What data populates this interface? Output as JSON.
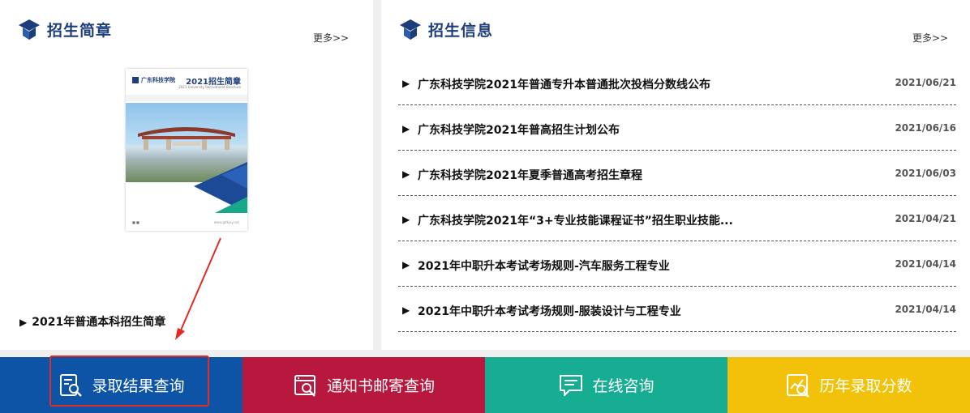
{
  "brochure_section": {
    "title": "招生简章",
    "more": "更多>>",
    "cover": {
      "school_name": "广东科技学院",
      "title": "2021招生简章",
      "subtitle": "2021 University Recruitment Brochure",
      "url": "www.gdkjxy.net"
    },
    "featured_link": "2021年普通本科招生简章"
  },
  "news_section": {
    "title": "招生信息",
    "more": "更多>>",
    "items": [
      {
        "title": "广东科技学院2021年普通专升本普通批次投档分数线公布",
        "date": "2021/06/21"
      },
      {
        "title": "广东科技学院2021年普高招生计划公布",
        "date": "2021/06/16"
      },
      {
        "title": "广东科技学院2021年夏季普通高考招生章程",
        "date": "2021/06/03"
      },
      {
        "title": "广东科技学院2021年“3+专业技能课程证书”招生职业技能...",
        "date": "2021/04/21"
      },
      {
        "title": "2021年中职升本考试考场规则-汽车服务工程专业",
        "date": "2021/04/14"
      },
      {
        "title": "2021年中职升本考试考场规则-服装设计与工程专业",
        "date": "2021/04/14"
      }
    ]
  },
  "quick_links": [
    {
      "label": "录取结果查询",
      "icon": "search-document-icon",
      "color": "#0d54a6"
    },
    {
      "label": "通知书邮寄查询",
      "icon": "mail-search-icon",
      "color": "#b8173e"
    },
    {
      "label": "在线咨询",
      "icon": "chat-icon",
      "color": "#17ad93"
    },
    {
      "label": "历年录取分数",
      "icon": "chart-search-icon",
      "color": "#f2c20b"
    }
  ],
  "colors": {
    "heading": "#1d3e7a",
    "annotation_red": "#e52a24"
  }
}
